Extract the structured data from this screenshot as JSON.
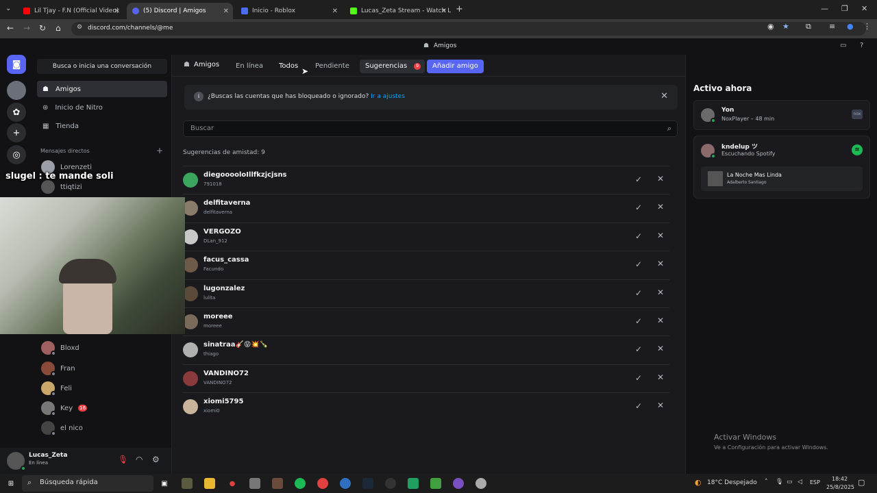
{
  "browser": {
    "tabs": [
      {
        "label": "Lil Tjay - F.N (Official Video)",
        "color": "#ff0000"
      },
      {
        "label": "(5) Discord | Amigos",
        "color": "#5865f2"
      },
      {
        "label": "Inicio - Roblox",
        "color": "#4a6cf7"
      },
      {
        "label": "Lucas_Zeta Stream - Watch Live",
        "color": "#53fc18"
      }
    ],
    "url": "discord.com/channels/@me"
  },
  "discord": {
    "top_title": "Amigos",
    "dm": {
      "search": "Busca o inicia una conversación",
      "nav": [
        {
          "label": "Amigos"
        },
        {
          "label": "Inicio de Nitro"
        },
        {
          "label": "Tienda"
        }
      ],
      "dm_header": "Mensajes directos",
      "dm_top": [
        {
          "name": "Lorenzeti"
        },
        {
          "name": "ttiqtizi"
        }
      ],
      "dm_bottom": [
        {
          "name": "Bloxd"
        },
        {
          "name": "Fran"
        },
        {
          "name": "Feli"
        },
        {
          "name": "Key",
          "badge": "16"
        },
        {
          "name": "el nico"
        }
      ]
    },
    "user": {
      "name": "Lucas_Zeta",
      "status": "En línea"
    },
    "header": {
      "friends": "Amigos",
      "online": "En línea",
      "all": "Todos",
      "pending": "Pendiente",
      "suggestions": "Sugerencias",
      "suggestions_badge": "9",
      "add_friend": "Añadir amigo"
    },
    "notice": {
      "text": "¿Buscas las cuentas que has bloqueado o ignorado?",
      "link": "Ir a ajustes"
    },
    "search_placeholder": "Buscar",
    "suggestions_count_label": "Sugerencias de amistad: 9",
    "suggestions": [
      {
        "name": "diegooooloIllfkzjcjsns",
        "sub": "791018",
        "color": "#3ba55d"
      },
      {
        "name": "delfitaverna",
        "sub": "delfitaverna",
        "color": "#8a7a6a"
      },
      {
        "name": "VERGOZO",
        "sub": "DLan_912",
        "color": "#c8c8c8"
      },
      {
        "name": "facus_cassa",
        "sub": "Facundo",
        "color": "#6e5a48"
      },
      {
        "name": "lugonzalez",
        "sub": "lulita",
        "color": "#5a4a3a"
      },
      {
        "name": "moreee",
        "sub": "moreee",
        "color": "#7a6a5a"
      },
      {
        "name": "sinatraa🎸😝💥🍾",
        "sub": "thiago",
        "color": "#b0b0b0"
      },
      {
        "name": "VANDINO72",
        "sub": "VANDINO72",
        "color": "#8a3a3a"
      },
      {
        "name": "xiomi5795",
        "sub": "xiomi0",
        "color": "#c9b39a"
      }
    ],
    "active_now": {
      "title": "Activo ahora",
      "items": [
        {
          "name": "Yon",
          "activity": "NoxPlayer – 48 min"
        },
        {
          "name": "kndelup ツ",
          "activity": "Escuchando Spotify",
          "song": "La Noche Mas Linda",
          "artist": "Adalberto Santiago"
        }
      ]
    }
  },
  "overlay": {
    "chat_text": "slugel : te mande soli"
  },
  "windows_watermark": {
    "title": "Activar Windows",
    "subtitle": "Ve a Configuración para activar Windows."
  },
  "taskbar": {
    "search": "Búsqueda rápida",
    "weather": "18°C  Despejado",
    "lang": "ESP",
    "time": "18:42",
    "date": "25/8/2025"
  }
}
